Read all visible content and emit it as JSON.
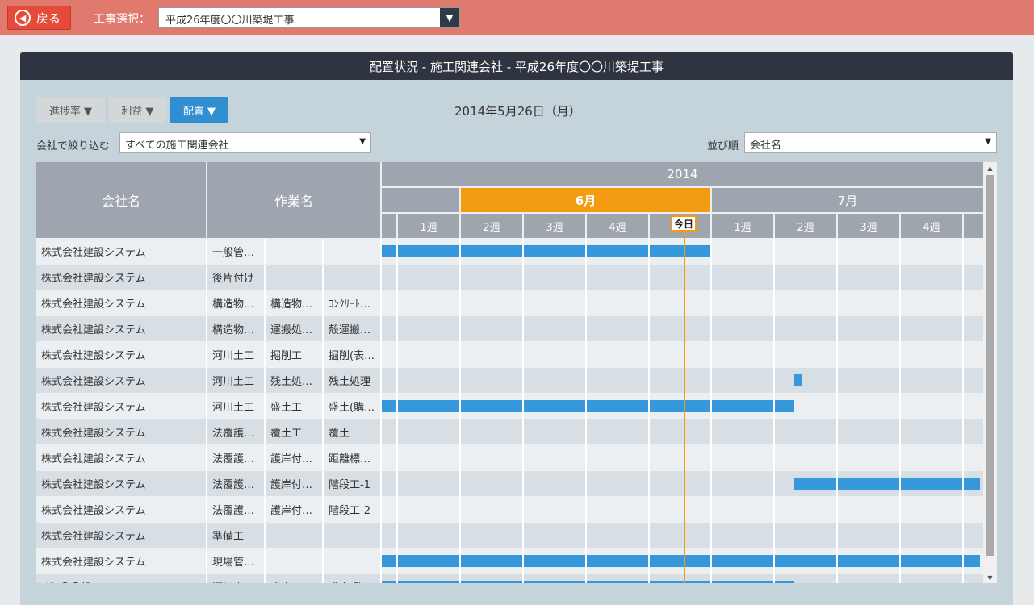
{
  "topbar": {
    "back_label": "戻る",
    "back_icon": "arrow-left-circle-icon",
    "project_label": "工事選択：",
    "project_value": "平成26年度〇〇川築堤工事"
  },
  "panel": {
    "title": "配置状況 - 施工関連会社 - 平成26年度〇〇川築堤工事",
    "toggles": [
      {
        "label": "進捗率 ▼",
        "active": false
      },
      {
        "label": "利益 ▼",
        "active": false
      },
      {
        "label": "配置 ▼",
        "active": true
      }
    ],
    "date": "2014年5月26日（月）",
    "filter_label": "会社で絞り込む",
    "filter_value": "すべての施工関連会社",
    "sort_label": "並び順",
    "sort_value": "会社名"
  },
  "grid": {
    "col_company": "会社名",
    "col_task": "作業名",
    "year": "2014",
    "months": [
      "6月",
      "7月"
    ],
    "weeks": [
      "1週",
      "2週",
      "3週",
      "4週",
      "",
      "1週",
      "2週",
      "3週",
      "4週"
    ],
    "today_label": "今日",
    "rows": [
      {
        "company": "株式会社建設システム",
        "t1": "一般管…",
        "t2": "",
        "t3": "",
        "bars": [
          [
            0,
            5.2
          ]
        ]
      },
      {
        "company": "株式会社建設システム",
        "t1": "後片付け",
        "t2": "",
        "t3": "",
        "bars": []
      },
      {
        "company": "株式会社建設システム",
        "t1": "構造物…",
        "t2": "構造物…",
        "t3": "ｺﾝｸﾘｰﾄ…",
        "bars": []
      },
      {
        "company": "株式会社建設システム",
        "t1": "構造物…",
        "t2": "運搬処…",
        "t3": "殻運搬…",
        "bars": []
      },
      {
        "company": "株式会社建設システム",
        "t1": "河川土工",
        "t2": "掘削工",
        "t3": "掘削(表…",
        "bars": []
      },
      {
        "company": "株式会社建設システム",
        "t1": "河川土工",
        "t2": "残土処…",
        "t3": "残土処理",
        "bars": [
          [
            6.55,
            6.68
          ]
        ]
      },
      {
        "company": "株式会社建設システム",
        "t1": "河川土工",
        "t2": "盛土工",
        "t3": "盛土(購…",
        "bars": [
          [
            0,
            6.55
          ]
        ]
      },
      {
        "company": "株式会社建設システム",
        "t1": "法覆護…",
        "t2": "覆土工",
        "t3": "覆土",
        "bars": []
      },
      {
        "company": "株式会社建設システム",
        "t1": "法覆護…",
        "t2": "護岸付…",
        "t3": "距離標…",
        "bars": []
      },
      {
        "company": "株式会社建設システム",
        "t1": "法覆護…",
        "t2": "護岸付…",
        "t3": "階段工-1",
        "bars": [
          [
            6.55,
            9.5
          ]
        ]
      },
      {
        "company": "株式会社建設システム",
        "t1": "法覆護…",
        "t2": "護岸付…",
        "t3": "階段工-2",
        "bars": []
      },
      {
        "company": "株式会社建設システム",
        "t1": "準備工",
        "t2": "",
        "t3": "",
        "bars": []
      },
      {
        "company": "株式会社建設システム",
        "t1": "現場管…",
        "t2": "",
        "t3": "",
        "bars": [
          [
            0,
            9.5
          ]
        ]
      },
      {
        "company": "(株)〇〇組",
        "t1": "河川土工",
        "t2": "盛土工",
        "t3": "盛土(購…",
        "bars": [
          [
            0,
            6.55
          ]
        ]
      }
    ]
  },
  "colors": {
    "bar": "#3498db",
    "today": "#f39c12",
    "accent": "#2f8fd0"
  }
}
